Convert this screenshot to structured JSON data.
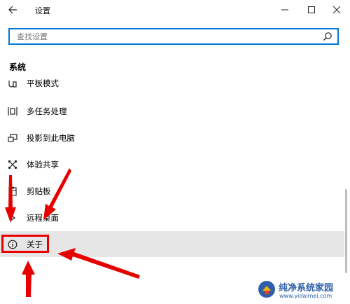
{
  "window": {
    "title": "设置"
  },
  "search": {
    "placeholder": "查找设置"
  },
  "section": {
    "title": "系统"
  },
  "items": [
    {
      "label": "平板模式",
      "icon": "tablet-mode-icon"
    },
    {
      "label": "多任务处理",
      "icon": "multitasking-icon"
    },
    {
      "label": "投影到此电脑",
      "icon": "project-to-pc-icon"
    },
    {
      "label": "体验共享",
      "icon": "shared-experiences-icon"
    },
    {
      "label": "剪贴板",
      "icon": "clipboard-icon"
    },
    {
      "label": "远程桌面",
      "icon": "remote-desktop-icon"
    },
    {
      "label": "关于",
      "icon": "info-icon",
      "selected": true
    }
  ],
  "colors": {
    "accent": "#0078d7",
    "highlight": "#e60000",
    "selected_bg": "#e6e6e6"
  },
  "watermark": {
    "name": "纯净系统家园",
    "url": "www.yidaimei.com"
  }
}
